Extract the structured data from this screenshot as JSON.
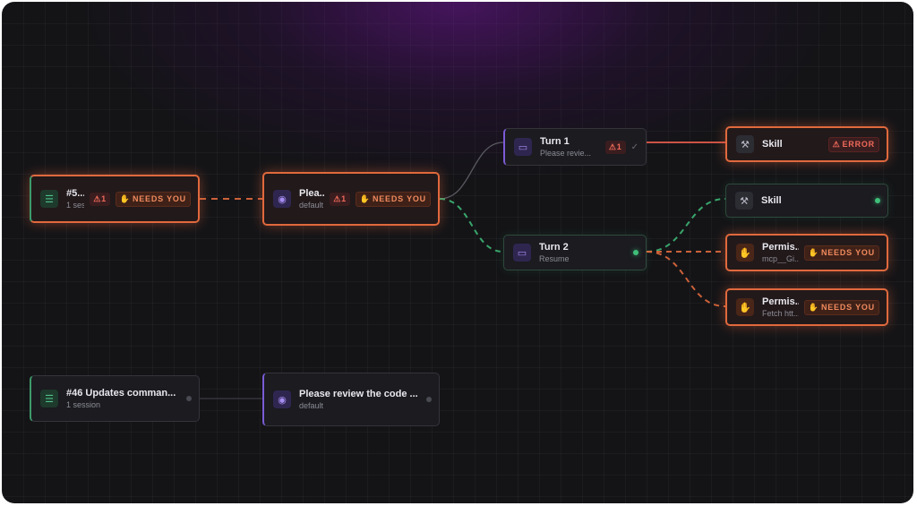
{
  "nodes": {
    "task_top": {
      "title": "#5...",
      "sub": "1 ses...",
      "warn": "⚠1",
      "needs": "NEEDS YOU"
    },
    "session_top": {
      "title": "Plea...",
      "sub": "default",
      "warn": "⚠1",
      "needs": "NEEDS YOU"
    },
    "turn1": {
      "title": "Turn 1",
      "sub": "Please revie...",
      "warn": "⚠1",
      "check": "✓"
    },
    "turn2": {
      "title": "Turn 2",
      "sub": "Resume"
    },
    "skill_error": {
      "title": "Skill",
      "error": "ERROR"
    },
    "skill_ok": {
      "title": "Skill"
    },
    "perm1": {
      "title": "Permis...",
      "sub": "mcp__Gi...",
      "needs": "NEEDS YOU"
    },
    "perm2": {
      "title": "Permis...",
      "sub": "Fetch htt...",
      "needs": "NEEDS YOU"
    },
    "task_bottom": {
      "title": "#46 Updates comman...",
      "sub": "1 session"
    },
    "session_bottom": {
      "title": "Please review the code ...",
      "sub": "default"
    }
  },
  "icons": {
    "task": "list-icon",
    "session": "bot-icon",
    "turn": "chat-icon",
    "skill": "wrench-icon",
    "permission": "hand-icon",
    "needs_you": "hand-icon",
    "warning": "warning-icon"
  },
  "colors": {
    "attention": "#e0693d",
    "error": "#f06a5a",
    "active": "#3fbf7a",
    "task_accent": "#3f9a6a",
    "session_accent": "#7b5cd6"
  }
}
